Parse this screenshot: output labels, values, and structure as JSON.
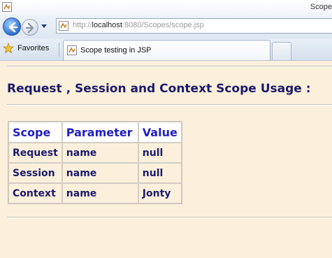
{
  "window": {
    "title": "Scope"
  },
  "addressbar": {
    "url_prefix": "http://",
    "url_host": "localhost",
    "url_rest": ":8080/Scopes/scope.jsp"
  },
  "favorites": {
    "label": "Favorites"
  },
  "tab": {
    "title": "Scope testing in JSP"
  },
  "page": {
    "heading": "Request , Session and Context Scope Usage :",
    "table": {
      "headers": [
        "Scope",
        "Parameter",
        "Value"
      ],
      "rows": [
        [
          "Request",
          "name",
          "null"
        ],
        [
          "Session",
          "name",
          "null"
        ],
        [
          "Context",
          "name",
          "Jonty"
        ]
      ]
    }
  },
  "colors": {
    "page_background": "#fcf0dc",
    "heading": "#1a1a6e",
    "table_header": "#1f1fc2",
    "table_cell": "#1a1a6e"
  },
  "icons": {
    "back": "back-arrow-icon",
    "forward": "forward-arrow-icon",
    "favorites": "star-icon",
    "page": "java-page-icon"
  }
}
